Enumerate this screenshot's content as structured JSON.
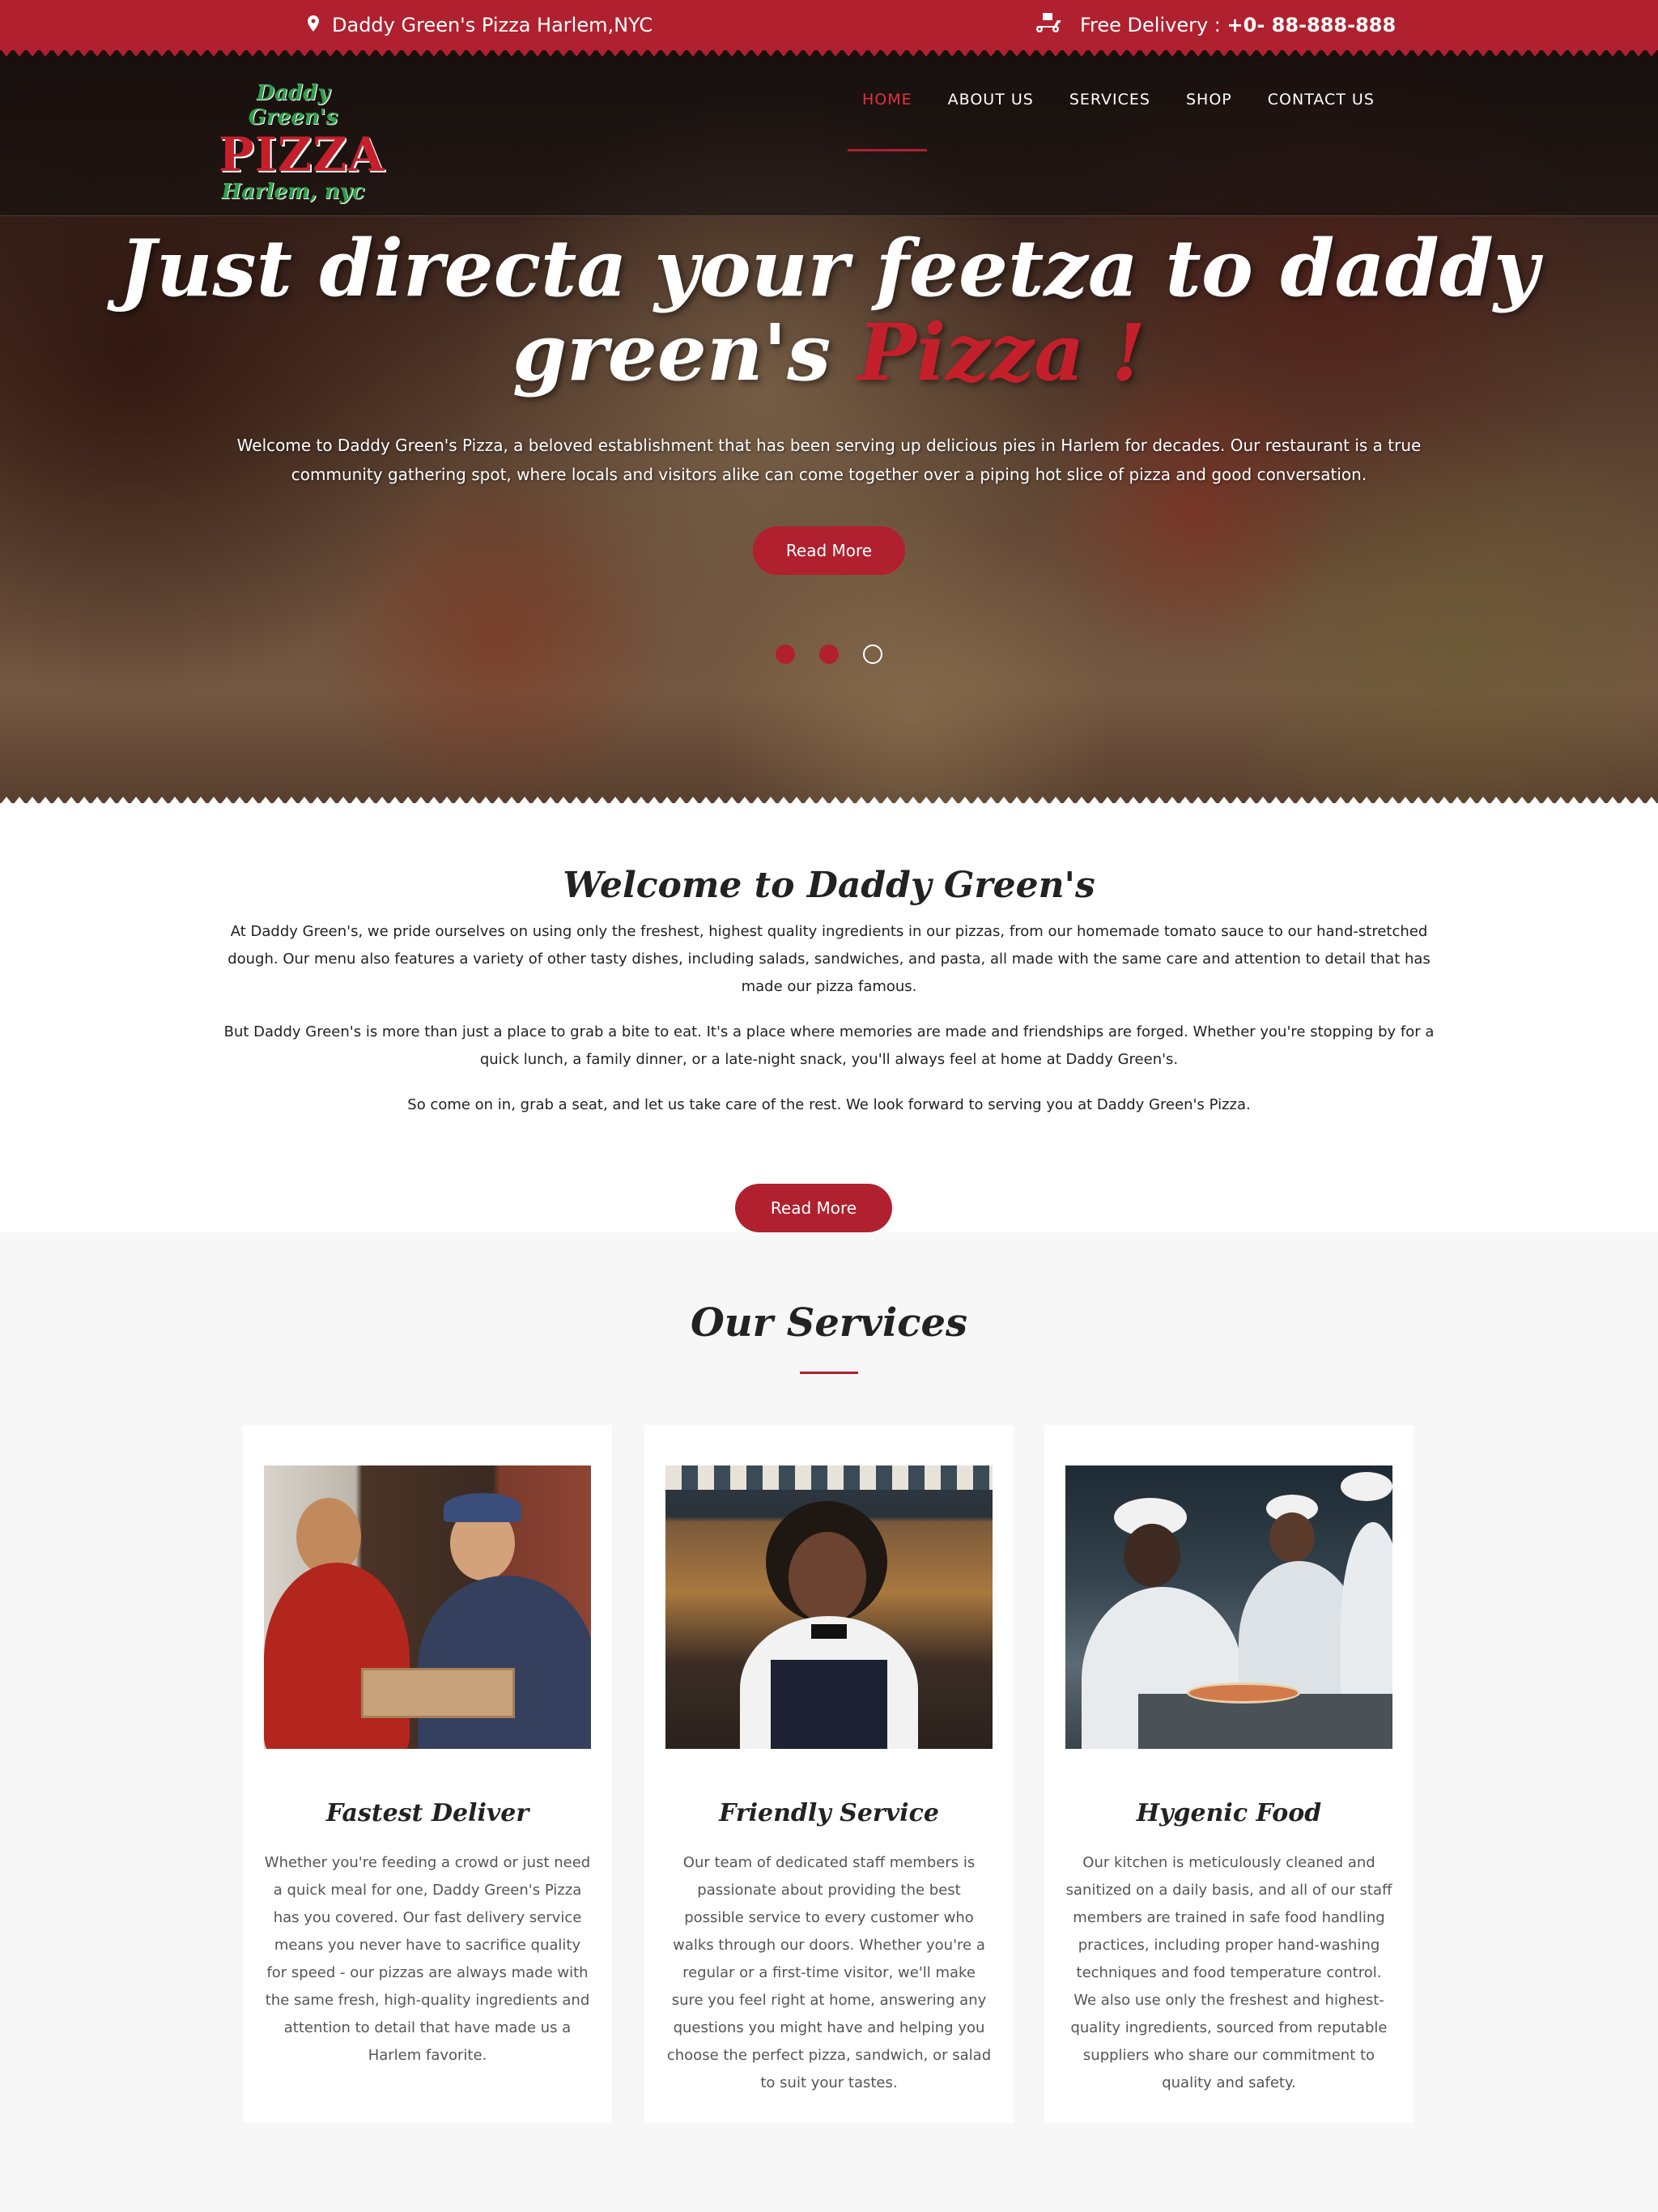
{
  "topbar": {
    "location": "Daddy Green's Pizza Harlem,NYC",
    "delivery_label": "Free Delivery :",
    "delivery_phone": "+0- 88-888-888"
  },
  "logo": {
    "line1": "Daddy Green's",
    "line2": "PIZZA",
    "line3": "Harlem, nyc"
  },
  "nav": {
    "items": [
      "HOME",
      "ABOUT US",
      "SERVICES",
      "SHOP",
      "CONTACT US"
    ],
    "active_index": 0
  },
  "hero": {
    "title_line1": "Just directa your feetza to daddy",
    "title_line2": "green's",
    "title_accent": "Pizza !",
    "text": "Welcome to Daddy Green's Pizza, a beloved establishment that has been serving up delicious pies in Harlem for decades. Our restaurant is a true community gathering spot, where locals and visitors alike can come together over a piping hot slice of pizza and good conversation.",
    "button": "Read More",
    "slide_count": 3,
    "active_slide": 3
  },
  "welcome": {
    "title": "Welcome to Daddy Green's",
    "paragraphs": [
      "At Daddy Green's, we pride ourselves on using only the freshest, highest quality ingredients in our pizzas, from our homemade tomato sauce to our hand-stretched dough. Our menu also features a variety of other tasty dishes, including salads, sandwiches, and pasta, all made with the same care and attention to detail that has made our pizza famous.",
      "But Daddy Green's is more than just a place to grab a bite to eat. It's a place where memories are made and friendships are forged. Whether you're stopping by for a quick lunch, a family dinner, or a late-night snack, you'll always feel at home at Daddy Green's.",
      "So come on in, grab a seat, and let us take care of the rest. We look forward to serving you at Daddy Green's Pizza."
    ],
    "button": "Read More"
  },
  "services": {
    "title": "Our Services",
    "cards": [
      {
        "title": "Fastest Deliver",
        "text": "Whether you're feeding a crowd or just need a quick meal for one, Daddy Green's Pizza has you covered. Our fast delivery service means you never have to sacrifice quality for speed - our pizzas are always made with the same fresh, high-quality ingredients and attention to detail that have made us a Harlem favorite."
      },
      {
        "title": "Friendly Service",
        "text": "Our team of dedicated staff members is passionate about providing the best possible service to every customer who walks through our doors. Whether you're a regular or a first-time visitor, we'll make sure you feel right at home, answering any questions you might have and helping you choose the perfect pizza, sandwich, or salad to suit your tastes."
      },
      {
        "title": "Hygenic Food",
        "text": "Our kitchen is meticulously cleaned and sanitized on a daily basis, and all of our staff members are trained in safe food handling practices, including proper hand-washing techniques and food temperature control. We also use only the freshest and highest-quality ingredients, sourced from reputable suppliers who share our commitment to quality and safety."
      }
    ]
  },
  "colors": {
    "brand_red": "#b1202e",
    "logo_green": "#2f9e4a",
    "section_gray": "#f7f7f7"
  },
  "icons": {
    "location": "map-pin-icon",
    "delivery": "delivery-scooter-icon"
  }
}
